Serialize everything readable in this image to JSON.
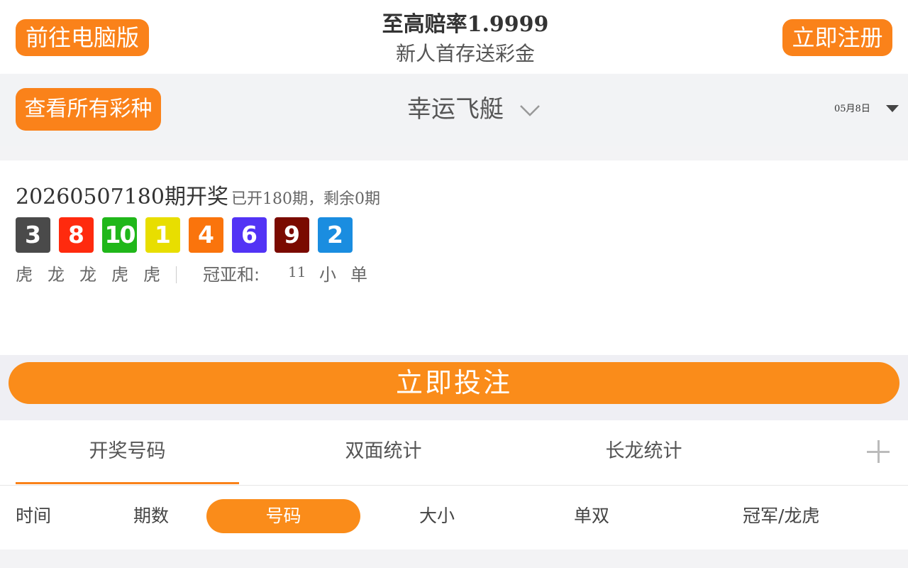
{
  "header": {
    "pc_button": "前往电脑版",
    "title": "至高赔率1.9999",
    "subtitle": "新人首存送彩金",
    "register_button": "立即注册"
  },
  "subbar": {
    "all_lotteries_button": "查看所有彩种",
    "lottery_name": "幸运飞艇",
    "date": "05月8日"
  },
  "result": {
    "issue_number": "20260507180",
    "issue_label": "期开奖",
    "summary": "已开180期，剩余0期",
    "balls": [
      {
        "number": "3",
        "color": "#4a4a4a"
      },
      {
        "number": "8",
        "color": "#ff2a0e"
      },
      {
        "number": "10",
        "color": "#20b71a"
      },
      {
        "number": "1",
        "color": "#e8de00"
      },
      {
        "number": "4",
        "color": "#fa740c"
      },
      {
        "number": "6",
        "color": "#5233f5"
      },
      {
        "number": "9",
        "color": "#7a0a00"
      },
      {
        "number": "2",
        "color": "#1a8de0"
      }
    ],
    "dragon_tiger": [
      "虎",
      "龙",
      "龙",
      "虎",
      "虎"
    ],
    "sum_label": "冠亚和:",
    "sum_value": "11",
    "size": "小",
    "parity": "单"
  },
  "bet_button": "立即投注",
  "tabs": [
    "开奖号码",
    "双面统计",
    "长龙统计"
  ],
  "filters": [
    "时间",
    "期数",
    "号码",
    "大小",
    "单双",
    "冠军/龙虎"
  ],
  "colors": {
    "accent": "#fa821a",
    "bet": "#fa8c1a"
  }
}
